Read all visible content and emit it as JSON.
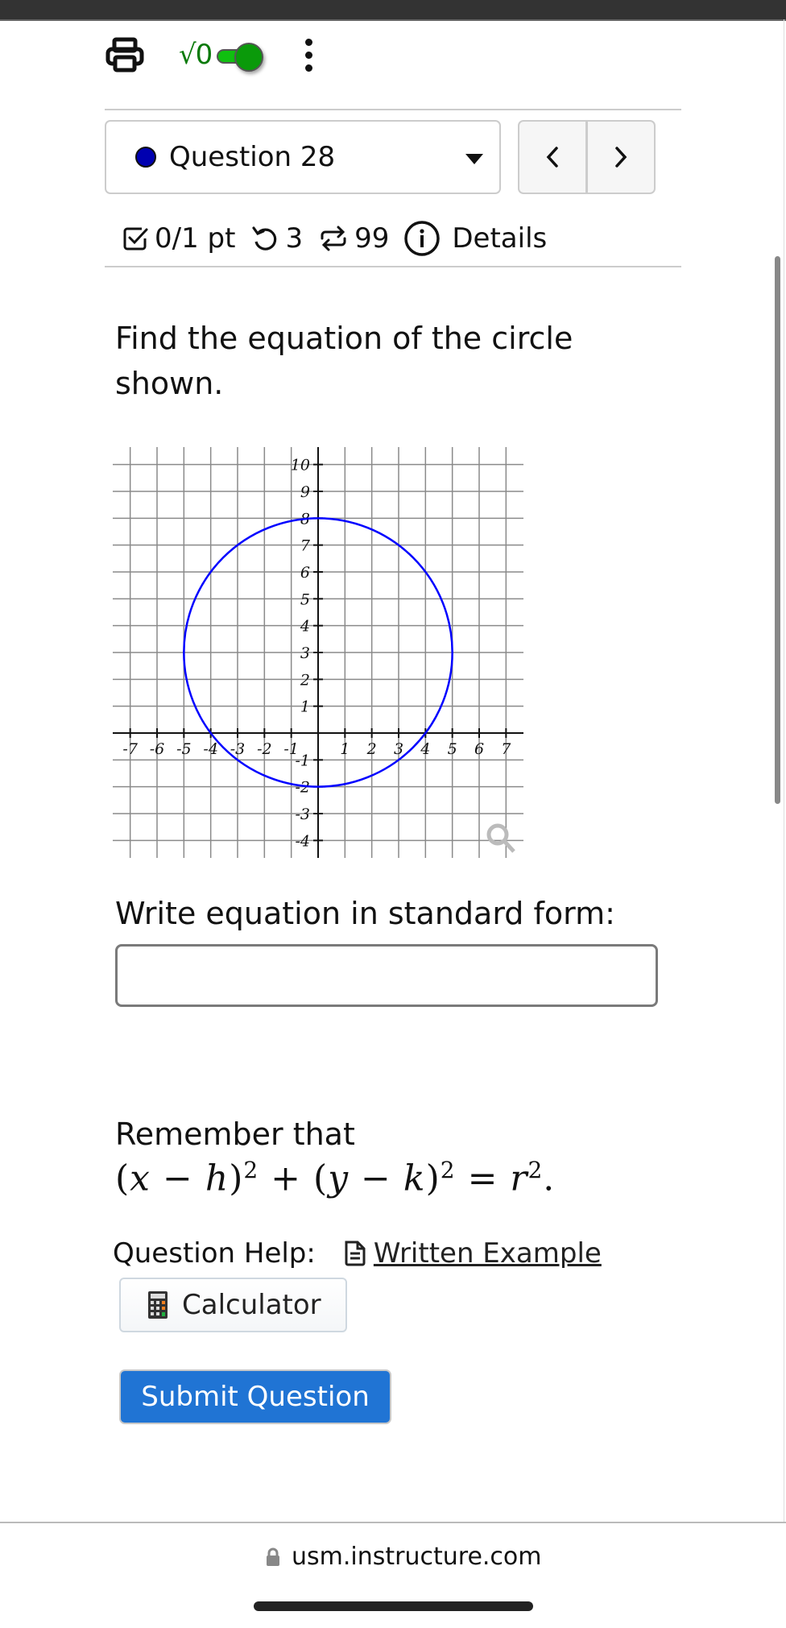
{
  "toolbar": {
    "print_icon": "printer-icon",
    "math_toggle_label": "√0",
    "math_toggle_on": true,
    "more_icon": "kebab-menu-icon"
  },
  "question_nav": {
    "selected": "Question 28",
    "status_dot_color": "#0000b0",
    "prev_label": "<",
    "next_label": ">"
  },
  "meta": {
    "score": "0/1 pt",
    "retries": "3",
    "attempts": "99",
    "details_label": "Details"
  },
  "question": {
    "text": "Find the equation of the circle shown.",
    "prompt": "Write equation in standard form:",
    "answer_value": "",
    "remember_text": "Remember that",
    "formula": "(x − h)² + (y − k)² = r²."
  },
  "help": {
    "label": "Question Help:",
    "written_example": "Written Example",
    "calculator": "Calculator"
  },
  "submit_label": "Submit Question",
  "browser": {
    "url": "usm.instructure.com"
  },
  "colors": {
    "circle": "#0000ff",
    "submit_bg": "#2074d4",
    "toggle_on": "#10c010"
  },
  "chart_data": {
    "type": "line",
    "title": "",
    "xlabel": "",
    "ylabel": "",
    "xlim": [
      -7.5,
      7.5
    ],
    "ylim": [
      -4.5,
      10.5
    ],
    "grid": true,
    "x_ticks": [
      -7,
      -6,
      -5,
      -4,
      -3,
      -2,
      -1,
      1,
      2,
      3,
      4,
      5,
      6,
      7
    ],
    "y_ticks": [
      -4,
      -3,
      -2,
      -1,
      1,
      2,
      3,
      4,
      5,
      6,
      7,
      8,
      9,
      10
    ],
    "series": [
      {
        "name": "circle",
        "shape": "circle",
        "center": [
          0,
          3
        ],
        "radius": 5,
        "color": "#0000ff"
      }
    ]
  }
}
